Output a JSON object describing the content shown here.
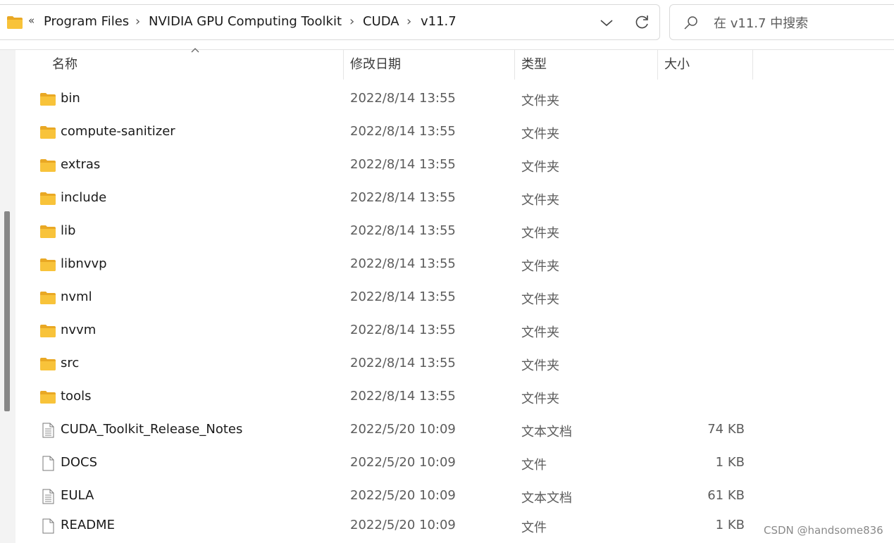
{
  "address_bar": {
    "overflow": "«",
    "breadcrumbs": [
      {
        "label": "Program Files"
      },
      {
        "label": "NVIDIA GPU Computing Toolkit"
      },
      {
        "label": "CUDA"
      },
      {
        "label": "v11.7"
      }
    ],
    "separator": "›"
  },
  "search": {
    "placeholder": "在 v11.7 中搜索"
  },
  "columns": {
    "name": "名称",
    "modified": "修改日期",
    "type": "类型",
    "size": "大小"
  },
  "rows": [
    {
      "name": "bin",
      "date": "2022/8/14 13:55",
      "type": "文件夹",
      "size": "",
      "icon": "folder-icon"
    },
    {
      "name": "compute-sanitizer",
      "date": "2022/8/14 13:55",
      "type": "文件夹",
      "size": "",
      "icon": "folder-icon"
    },
    {
      "name": "extras",
      "date": "2022/8/14 13:55",
      "type": "文件夹",
      "size": "",
      "icon": "folder-icon"
    },
    {
      "name": "include",
      "date": "2022/8/14 13:55",
      "type": "文件夹",
      "size": "",
      "icon": "folder-icon"
    },
    {
      "name": "lib",
      "date": "2022/8/14 13:55",
      "type": "文件夹",
      "size": "",
      "icon": "folder-icon"
    },
    {
      "name": "libnvvp",
      "date": "2022/8/14 13:55",
      "type": "文件夹",
      "size": "",
      "icon": "folder-icon"
    },
    {
      "name": "nvml",
      "date": "2022/8/14 13:55",
      "type": "文件夹",
      "size": "",
      "icon": "folder-icon"
    },
    {
      "name": "nvvm",
      "date": "2022/8/14 13:55",
      "type": "文件夹",
      "size": "",
      "icon": "folder-icon"
    },
    {
      "name": "src",
      "date": "2022/8/14 13:55",
      "type": "文件夹",
      "size": "",
      "icon": "folder-icon"
    },
    {
      "name": "tools",
      "date": "2022/8/14 13:55",
      "type": "文件夹",
      "size": "",
      "icon": "folder-icon"
    },
    {
      "name": "CUDA_Toolkit_Release_Notes",
      "date": "2022/5/20 10:09",
      "type": "文本文档",
      "size": "74 KB",
      "icon": "text-document-icon"
    },
    {
      "name": "DOCS",
      "date": "2022/5/20 10:09",
      "type": "文件",
      "size": "1 KB",
      "icon": "blank-file-icon"
    },
    {
      "name": "EULA",
      "date": "2022/5/20 10:09",
      "type": "文本文档",
      "size": "61 KB",
      "icon": "text-document-icon"
    },
    {
      "name": "README",
      "date": "2022/5/20 10:09",
      "type": "文件",
      "size": "1 KB",
      "icon": "blank-file-icon"
    }
  ],
  "watermark": "CSDN @handsome836",
  "colors": {
    "folder": "#f8c33a",
    "folder_dark": "#e9a824",
    "text": "#1a1a1a",
    "secondary_text": "#5c5c5c"
  }
}
